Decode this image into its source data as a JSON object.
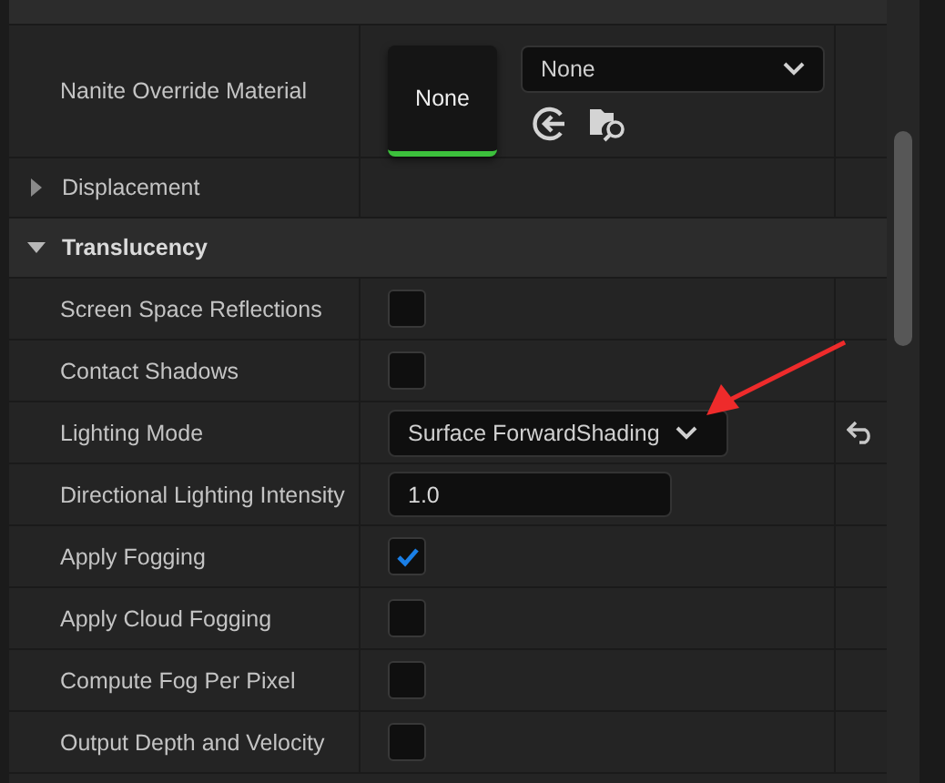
{
  "rows": [
    {
      "kind": "asset",
      "label": "Nanite Override Material",
      "thumbnail": "None",
      "value": "None"
    },
    {
      "kind": "group",
      "label": "Displacement",
      "expanded": false
    },
    {
      "kind": "group",
      "label": "Translucency",
      "expanded": true
    },
    {
      "kind": "checkbox",
      "label": "Screen Space Reflections",
      "checked": false
    },
    {
      "kind": "checkbox",
      "label": "Contact Shadows",
      "checked": false
    },
    {
      "kind": "dropdown",
      "label": "Lighting Mode",
      "value": "Surface ForwardShading",
      "modified": true
    },
    {
      "kind": "number",
      "label": "Directional Lighting Intensity",
      "value": "1.0"
    },
    {
      "kind": "checkbox",
      "label": "Apply Fogging",
      "checked": true
    },
    {
      "kind": "checkbox",
      "label": "Apply Cloud Fogging",
      "checked": false
    },
    {
      "kind": "checkbox",
      "label": "Compute Fog Per Pixel",
      "checked": false
    },
    {
      "kind": "checkbox",
      "label": "Output Depth and Velocity",
      "checked": false
    }
  ]
}
